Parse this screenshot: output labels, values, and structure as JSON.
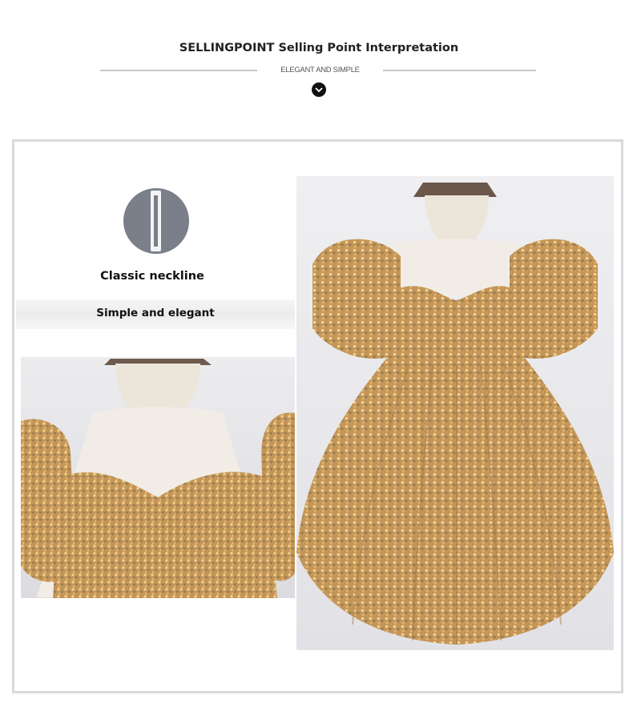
{
  "header": {
    "title": "SELLINGPOINT Selling Point Interpretation",
    "subtitle": "ELEGANT AND SIMPLE"
  },
  "feature": {
    "icon": "neckline-icon",
    "title": "Classic neckline",
    "subtitle": "Simple and elegant"
  },
  "photos": [
    {
      "name": "neckline-detail-photo",
      "depicts": "close-up of gold sequin dress neckline on mannequin"
    },
    {
      "name": "full-dress-photo",
      "depicts": "gold sequin puff-sleeve dress on mannequin"
    }
  ],
  "colors": {
    "accent_dark": "#111111",
    "icon_grey": "#7a7f89",
    "divider": "#c8c8c8",
    "frame": "#d9d9de",
    "fabric_gold": "#c69a5c"
  }
}
